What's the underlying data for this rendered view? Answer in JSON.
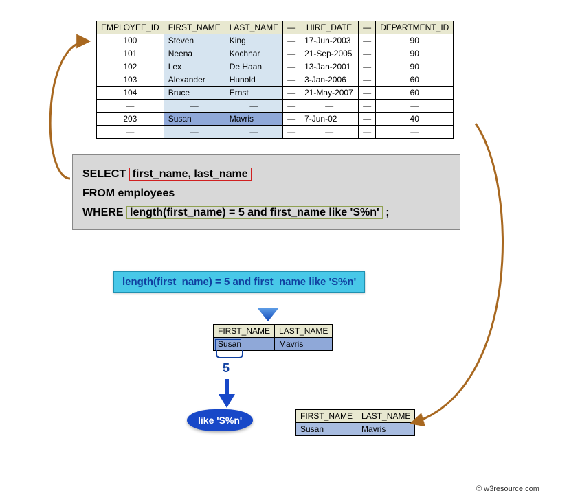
{
  "table": {
    "headers": {
      "emp_id": "EMPLOYEE_ID",
      "first_name": "FIRST_NAME",
      "last_name": "LAST_NAME",
      "hire_date": "HIRE_DATE",
      "department_id": "DEPARTMENT_ID",
      "dash": "—"
    },
    "rows": [
      {
        "emp_id": "100",
        "first_name": "Steven",
        "last_name": "King",
        "d1": "—",
        "hire_date": "17-Jun-2003",
        "d2": "—",
        "department_id": "90"
      },
      {
        "emp_id": "101",
        "first_name": "Neena",
        "last_name": "Kochhar",
        "d1": "—",
        "hire_date": "21-Sep-2005",
        "d2": "—",
        "department_id": "90"
      },
      {
        "emp_id": "102",
        "first_name": "Lex",
        "last_name": "De Haan",
        "d1": "—",
        "hire_date": "13-Jan-2001",
        "d2": "—",
        "department_id": "90"
      },
      {
        "emp_id": "103",
        "first_name": "Alexander",
        "last_name": "Hunold",
        "d1": "—",
        "hire_date": "3-Jan-2006",
        "d2": "—",
        "department_id": "60"
      },
      {
        "emp_id": "104",
        "first_name": "Bruce",
        "last_name": "Ernst",
        "d1": "—",
        "hire_date": "21-May-2007",
        "d2": "—",
        "department_id": "60"
      },
      {
        "emp_id": "—",
        "first_name": "—",
        "last_name": "—",
        "d1": "—",
        "hire_date": "—",
        "d2": "—",
        "department_id": "—"
      },
      {
        "emp_id": "203",
        "first_name": "Susan",
        "last_name": "Mavris",
        "d1": "—",
        "hire_date": "7-Jun-02",
        "d2": "—",
        "department_id": "40"
      },
      {
        "emp_id": "—",
        "first_name": "—",
        "last_name": "—",
        "d1": "—",
        "hire_date": "—",
        "d2": "—",
        "department_id": "—"
      }
    ]
  },
  "sql": {
    "select": "SELECT",
    "cols": "first_name, last_name",
    "from": "FROM employees",
    "where": "WHERE",
    "cond": "length(first_name) = 5 and first_name like 'S%n'",
    "semi": ";"
  },
  "cond_label": "length(first_name) = 5 and first_name like 'S%n'",
  "intermediate": {
    "h1": "FIRST_NAME",
    "h2": "LAST_NAME",
    "c1": "Susan",
    "c2": "Mavris"
  },
  "final": {
    "h1": "FIRST_NAME",
    "h2": "LAST_NAME",
    "c1": "Susan",
    "c2": "Mavris"
  },
  "five": "5",
  "like_badge": "like 'S%n'",
  "copyright": "© w3resource.com"
}
